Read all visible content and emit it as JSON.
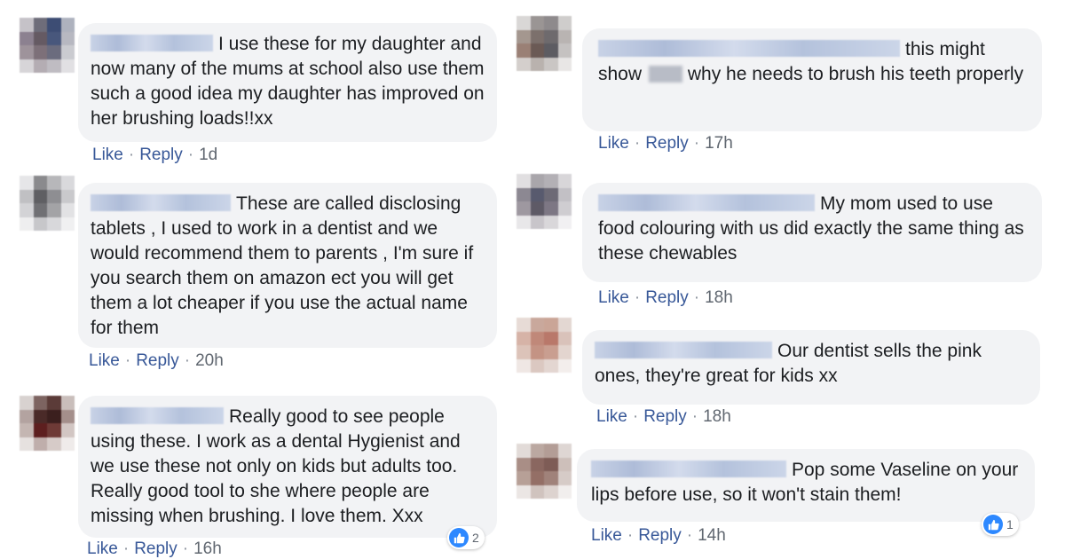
{
  "labels": {
    "like": "Like",
    "reply": "Reply",
    "sep": "·"
  },
  "comments": [
    {
      "text": "I use these for my daughter and now many of the mums at school also use them such a good idea my daughter has improved on her brushing loads!!xx",
      "time": "1d"
    },
    {
      "text": "These are called disclosing tablets , I used to work in a dentist and we would recommend them to parents , I'm sure if you search them on amazon ect you will get them a lot cheaper if you use the actual name for them",
      "time": "20h"
    },
    {
      "text": "Really good to see people using these. I work as a dental Hygienist and we use these not only on kids but adults too. Really good tool to she where people are missing when brushing. I love them. Xxx",
      "time": "16h",
      "reactions": "2"
    },
    {
      "text_before": "this might show",
      "text_after": "why he needs to brush his teeth properly",
      "time": "17h"
    },
    {
      "text": "My mom used to use food colouring with us did exactly the same thing as these chewables",
      "time": "18h"
    },
    {
      "text": "Our dentist sells the pink ones, they're great for kids xx",
      "time": "18h"
    },
    {
      "text": "Pop some Vaseline on your lips before use, so it won't stain them!",
      "time": "14h",
      "reactions": "1"
    }
  ],
  "colors": {
    "bubble": "#f2f3f5",
    "link": "#385898",
    "like_badge": "#2d88ff"
  },
  "icons": {
    "reaction": "thumbs-up-icon"
  }
}
